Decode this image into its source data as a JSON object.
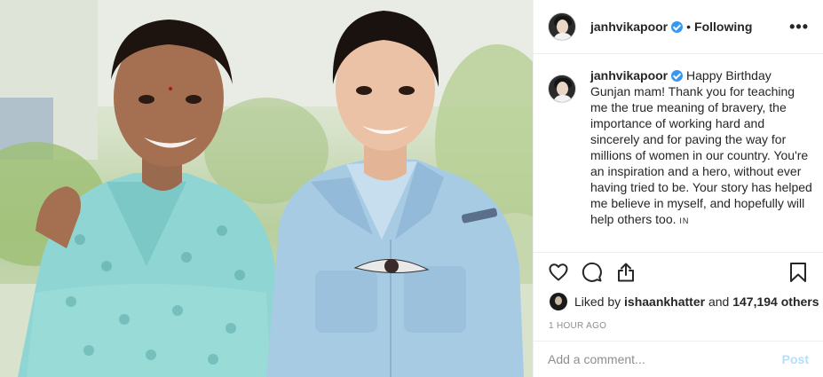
{
  "header": {
    "username": "janhvikapoor",
    "separator": "•",
    "follow_status": "Following",
    "more_label": "•••"
  },
  "caption": {
    "username": "janhvikapoor",
    "text": "Happy Birthday Gunjan mam! Thank you for teaching me the true meaning of bravery, the importance of working hard and sincerely and for paving the way for millions of women in our country. You're an inspiration and a hero, without ever having tried to be. Your story has helped me believe in myself, and hopefully will help others too.",
    "flag": "IN"
  },
  "likes": {
    "prefix": "Liked by",
    "first_user": "ishaankhatter",
    "connector": "and",
    "others": "147,194 others"
  },
  "timestamp": "1 HOUR AGO",
  "comment_box": {
    "placeholder": "Add a comment...",
    "post_label": "Post"
  },
  "icons": {
    "like": "heart-icon",
    "comment": "comment-icon",
    "share": "share-icon",
    "save": "bookmark-icon",
    "verified": "verified-badge-icon"
  },
  "colors": {
    "verified": "#3897f0",
    "post_button_disabled": "#b2dffc",
    "muted_text": "#8e8e8e"
  }
}
